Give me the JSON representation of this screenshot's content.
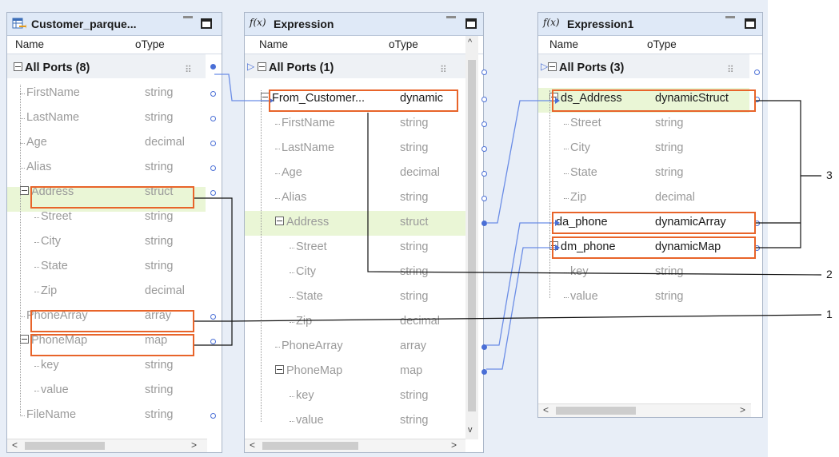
{
  "panels": {
    "customer": {
      "title": "Customer_parque...",
      "col_name": "Name",
      "col_type": "Type",
      "group": "All Ports (8)",
      "rows": [
        {
          "name": "FirstName",
          "type": "string"
        },
        {
          "name": "LastName",
          "type": "string"
        },
        {
          "name": "Age",
          "type": "decimal"
        },
        {
          "name": "Alias",
          "type": "string"
        },
        {
          "name": "Address",
          "type": "struct"
        },
        {
          "name": "Street",
          "type": "string"
        },
        {
          "name": "City",
          "type": "string"
        },
        {
          "name": "State",
          "type": "string"
        },
        {
          "name": "Zip",
          "type": "decimal"
        },
        {
          "name": "PhoneArray",
          "type": "array"
        },
        {
          "name": "PhoneMap",
          "type": "map"
        },
        {
          "name": "key",
          "type": "string"
        },
        {
          "name": "value",
          "type": "string"
        },
        {
          "name": "FileName",
          "type": "string"
        }
      ]
    },
    "expression": {
      "title": "Expression",
      "fx": "f(x)",
      "col_name": "Name",
      "col_type": "Type",
      "group": "All Ports (1)",
      "rows": [
        {
          "name": "From_Customer...",
          "type": "dynamic"
        },
        {
          "name": "FirstName",
          "type": "string"
        },
        {
          "name": "LastName",
          "type": "string"
        },
        {
          "name": "Age",
          "type": "decimal"
        },
        {
          "name": "Alias",
          "type": "string"
        },
        {
          "name": "Address",
          "type": "struct"
        },
        {
          "name": "Street",
          "type": "string"
        },
        {
          "name": "City",
          "type": "string"
        },
        {
          "name": "State",
          "type": "string"
        },
        {
          "name": "Zip",
          "type": "decimal"
        },
        {
          "name": "PhoneArray",
          "type": "array"
        },
        {
          "name": "PhoneMap",
          "type": "map"
        },
        {
          "name": "key",
          "type": "string"
        },
        {
          "name": "value",
          "type": "string"
        }
      ]
    },
    "expression1": {
      "title": "Expression1",
      "fx": "f(x)",
      "col_name": "Name",
      "col_type": "Type",
      "group": "All Ports (3)",
      "rows": [
        {
          "name": "ds_Address",
          "type": "dynamicStruct"
        },
        {
          "name": "Street",
          "type": "string"
        },
        {
          "name": "City",
          "type": "string"
        },
        {
          "name": "State",
          "type": "string"
        },
        {
          "name": "Zip",
          "type": "decimal"
        },
        {
          "name": "da_phone",
          "type": "dynamicArray"
        },
        {
          "name": "dm_phone",
          "type": "dynamicMap"
        },
        {
          "name": "key",
          "type": "string"
        },
        {
          "name": "value",
          "type": "string"
        }
      ]
    }
  },
  "callouts": [
    "3",
    "2",
    "1"
  ],
  "colors": {
    "accent_orange": "#e8642a",
    "link_blue": "#4a6fd6",
    "highlight_green": "#eaf6d6"
  }
}
